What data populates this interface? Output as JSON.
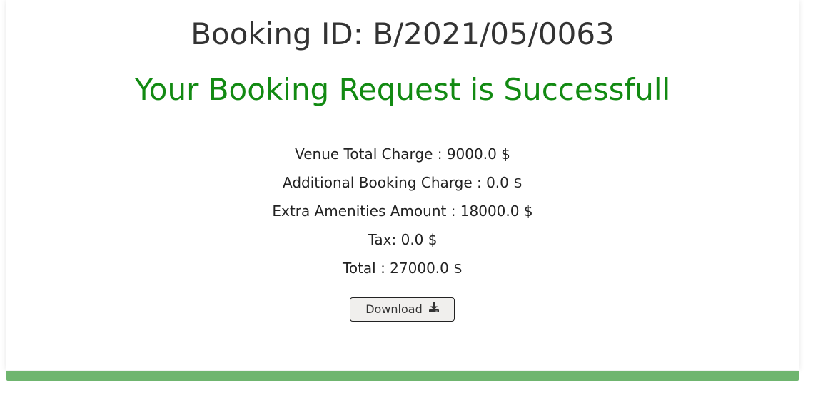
{
  "booking": {
    "id_text": "Booking ID: B/2021/05/0063",
    "success_message": "Your Booking Request is Successfull"
  },
  "charges": {
    "venue_total": "Venue Total Charge : 9000.0 $",
    "additional": "Additional Booking Charge : 0.0 $",
    "extra_amenities": "Extra Amenities Amount : 18000.0 $",
    "tax": "Tax: 0.0 $",
    "total": "Total : 27000.0 $"
  },
  "actions": {
    "download_label": "Download"
  },
  "icons": {
    "download": "download-icon"
  },
  "colors": {
    "success": "#128a12",
    "bottom_bar": "#6fb56f",
    "heading": "#333333"
  }
}
